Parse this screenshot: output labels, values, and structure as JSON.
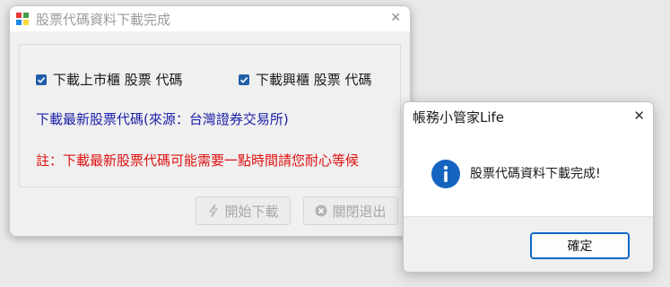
{
  "main_window": {
    "title": "股票代碼資料下載完成",
    "close_glyph": "✕",
    "checkboxes": [
      {
        "label": "下載上市櫃 股票 代碼",
        "checked": true
      },
      {
        "label": "下載興櫃 股票 代碼",
        "checked": true
      }
    ],
    "info_text": "下載最新股票代碼(來源：台灣證券交易所)",
    "note_text": "註：下載最新股票代碼可能需要一點時間請您耐心等候",
    "start_button_label": "開始下載",
    "exit_button_label": "關閉退出",
    "icons": {
      "start": "lightning-icon",
      "exit": "close-circle-icon"
    }
  },
  "message_box": {
    "title": "帳務小管家Life",
    "close_glyph": "✕",
    "message": "股票代碼資料下載完成!",
    "ok_label": "確定",
    "icon": "info-icon"
  },
  "colors": {
    "info_blue": "#1c20a8",
    "note_red": "#e01010",
    "checkbox_blue": "#1f5fa8",
    "info_icon": "#1565c0",
    "ok_border": "#0e66c7"
  }
}
